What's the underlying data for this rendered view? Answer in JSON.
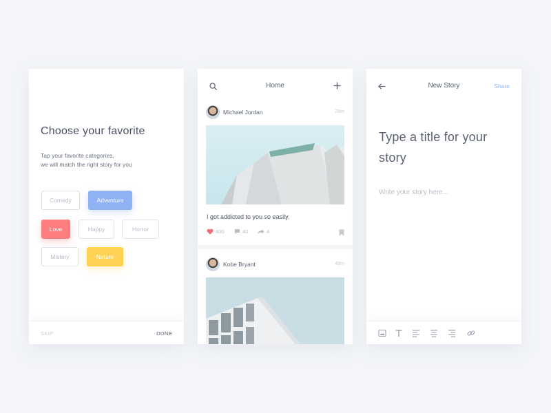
{
  "onboarding": {
    "title": "Choose your favorite",
    "subtitle_line1": "Tap your favorite categories,",
    "subtitle_line2": "we will match the right story for you",
    "categories": [
      {
        "label": "Comedy",
        "state": "unselected"
      },
      {
        "label": "Adventure",
        "state": "selected",
        "color": "#8fb2f5"
      },
      {
        "label": "Love",
        "state": "selected",
        "color": "#fe7d7f"
      },
      {
        "label": "Happy",
        "state": "unselected"
      },
      {
        "label": "Horror",
        "state": "unselected"
      },
      {
        "label": "Mistery",
        "state": "unselected"
      },
      {
        "label": "Nature",
        "state": "selected",
        "color": "#ffd253"
      }
    ],
    "skip_label": "SKIP",
    "done_label": "DONE"
  },
  "feed": {
    "title": "Home",
    "icons": [
      "search-icon",
      "plus-icon"
    ],
    "posts": [
      {
        "author": "Michael Jordan",
        "time": "28m",
        "caption": "I got addicted to you so easily.",
        "likes": "400",
        "comments": "40",
        "shares": "4"
      },
      {
        "author": "Kobe Bryant",
        "time": "48m"
      }
    ]
  },
  "editor": {
    "title": "New Story",
    "share_label": "Share",
    "story_title_placeholder": "Type a title for your story",
    "story_body_placeholder": "Write your story here...",
    "toolbar_icons": [
      "image-icon",
      "text-icon",
      "align-left-icon",
      "align-center-icon",
      "align-right-icon",
      "link-icon"
    ]
  },
  "colors": {
    "accent_blue": "#8fb2f5",
    "accent_red": "#fe7d7f",
    "accent_yellow": "#ffd253",
    "like_red": "#f36e72"
  }
}
